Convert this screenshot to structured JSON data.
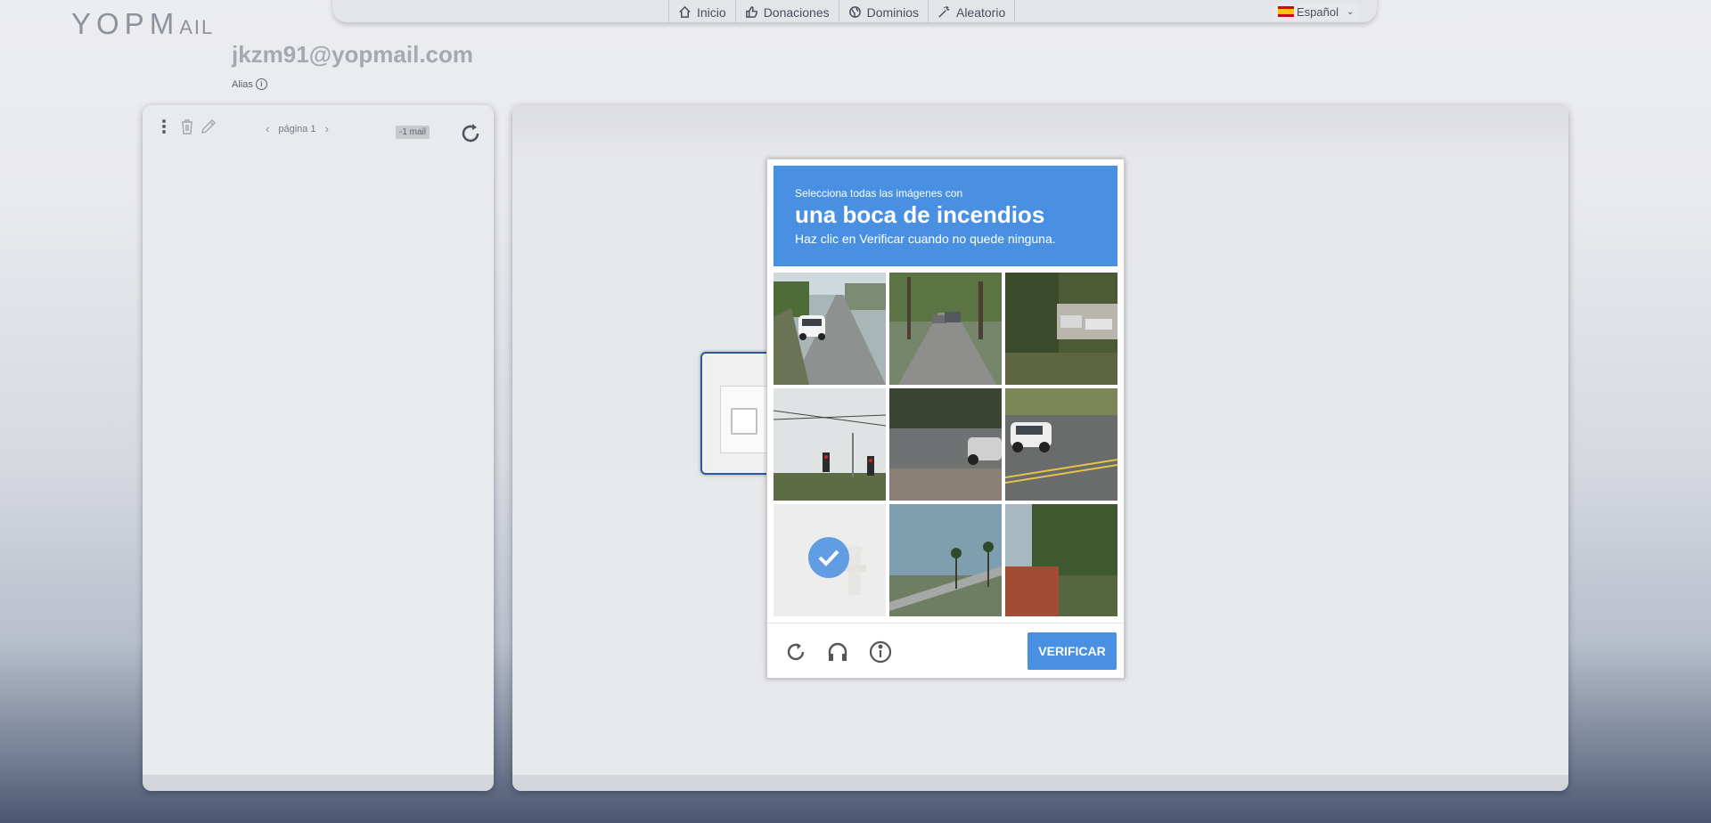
{
  "header": {
    "logo_main": "YOPM",
    "logo_tail": "AIL",
    "nav": [
      {
        "label": "Inicio",
        "icon": "home-icon"
      },
      {
        "label": "Donaciones",
        "icon": "thumbs-up-icon"
      },
      {
        "label": "Dominios",
        "icon": "globe-icon"
      },
      {
        "label": "Aleatorio",
        "icon": "magic-wand-icon"
      }
    ],
    "language": "Español"
  },
  "mailbox": {
    "address": "jkzm91@yopmail.com",
    "alias_label": "Alias",
    "pager_label": "página 1",
    "mail_count": "-1 mail"
  },
  "captcha": {
    "instruction_small": "Selecciona todas las imágenes con",
    "target": "una boca de incendios",
    "instruction_hint": "Haz clic en Verificar cuando no quede ninguna.",
    "verify_label": "VERIFICAR",
    "tiles": [
      {
        "scene": "road-with-white-car",
        "selected": false
      },
      {
        "scene": "tree-lined-street",
        "selected": false
      },
      {
        "scene": "house-behind-trees",
        "selected": false
      },
      {
        "scene": "traffic-lights-wires",
        "selected": false
      },
      {
        "scene": "intersection-suv",
        "selected": false
      },
      {
        "scene": "road-white-suv",
        "selected": false
      },
      {
        "scene": "fire-hydrant",
        "selected": true
      },
      {
        "scene": "palm-trees-sky",
        "selected": false
      },
      {
        "scene": "palm-tree-roof",
        "selected": false
      }
    ],
    "colors": {
      "accent": "#4a90e2"
    }
  }
}
